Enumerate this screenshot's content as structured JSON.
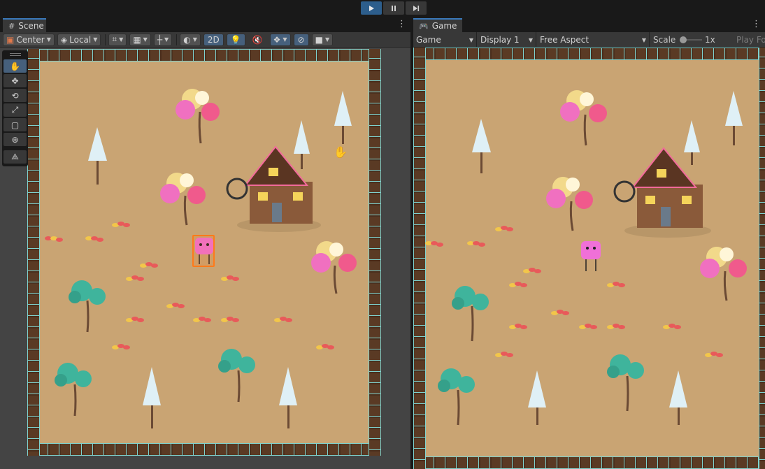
{
  "playbar": {
    "play": "play-icon",
    "pause": "pause-icon",
    "step": "step-icon"
  },
  "scene": {
    "tab_label": "Scene",
    "toolbar": {
      "pivot": "Center",
      "space": "Local",
      "mode_2d": "2D"
    },
    "tools": [
      "hand-tool",
      "move-tool",
      "rotate-tool",
      "scale-tool",
      "rect-tool",
      "transform-tool",
      "custom-tool"
    ]
  },
  "game": {
    "tab_label": "Game",
    "view": "Game",
    "display": "Display 1",
    "aspect": "Free Aspect",
    "scale_label": "Scale",
    "scale_value": "1x",
    "play_focused": "Play Fo"
  },
  "colors": {
    "accent": "#3a79bb",
    "ground": "#c9a473",
    "selection": "#ff7a1a"
  }
}
